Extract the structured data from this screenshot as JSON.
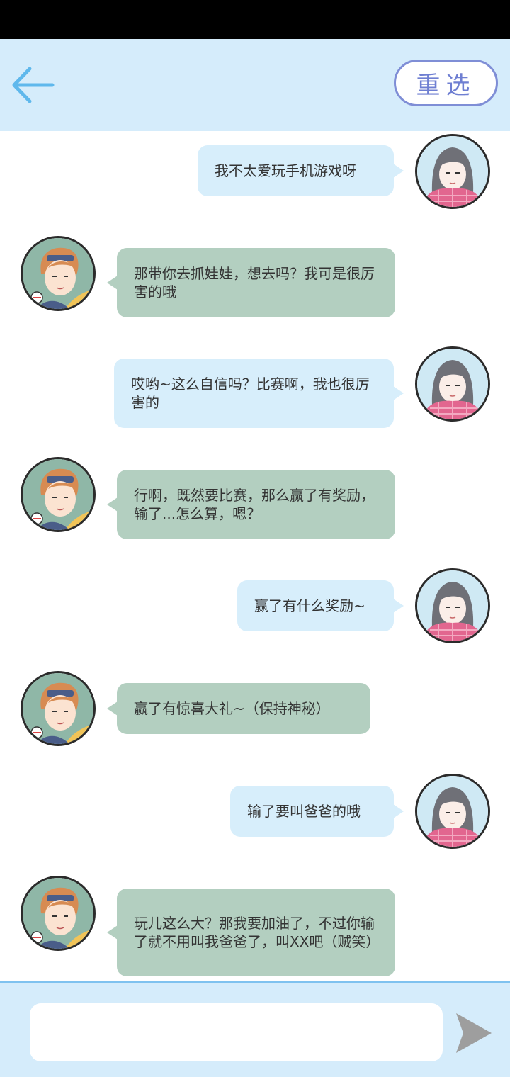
{
  "header": {
    "reselect_label": "重选"
  },
  "messages": [
    {
      "sender": "her",
      "text": "我不太爱玩手机游戏呀"
    },
    {
      "sender": "him",
      "text": "那带你去抓娃娃，想去吗？我可是很厉害的哦"
    },
    {
      "sender": "her",
      "text": "哎哟~这么自信吗？比赛啊，我也很厉害的"
    },
    {
      "sender": "him",
      "text": "行啊，既然要比赛，那么赢了有奖励，输了...怎么算，嗯？"
    },
    {
      "sender": "her",
      "text": "赢了有什么奖励~"
    },
    {
      "sender": "him",
      "text": "赢了有惊喜大礼~（保持神秘）"
    },
    {
      "sender": "her",
      "text": "输了要叫爸爸的哦"
    },
    {
      "sender": "him",
      "text": "玩儿这么大？那我要加油了，不过你输了就不用叫我爸爸了，叫XX吧（贼笑）"
    }
  ],
  "input": {
    "value": "",
    "placeholder": ""
  },
  "icons": {
    "back": "back-arrow-icon",
    "send": "send-icon"
  },
  "colors": {
    "header_bg": "#d5ecfb",
    "my_bubble": "#d7eefb",
    "his_bubble": "#b3cfc0",
    "accent": "#6f7fd2",
    "back_arrow": "#5fb8ec",
    "send_icon": "#9e9e9e"
  }
}
